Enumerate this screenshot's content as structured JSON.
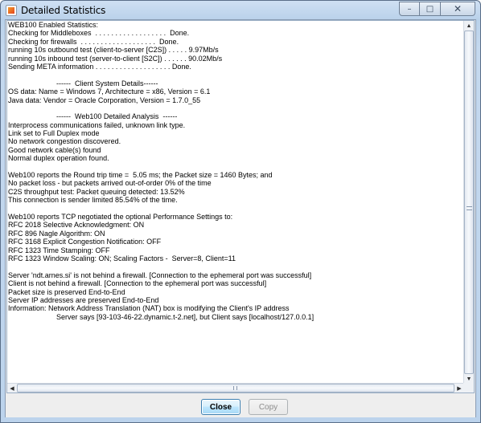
{
  "window": {
    "title": "Detailed Statistics",
    "caption_buttons": {
      "minimize": "–",
      "maximize": "□",
      "close": "✕"
    }
  },
  "text_lines": [
    "WEB100 Enabled Statistics:",
    "Checking for Middleboxes  . . . . . . . . . . . . . . . . . .  Done.",
    "Checking for firewalls  . . . . . . . . . . . . . . . . . . .  Done.",
    "running 10s outbound test (client-to-server [C2S]) . . . . . 9.97Mb/s",
    "running 10s inbound test (server-to-client [S2C]) . . . . . . 90.02Mb/s",
    "Sending META information . . . . . . . . . . . . . . . . . . . Done.",
    "",
    "                        ------  Client System Details------",
    "OS data: Name = Windows 7, Architecture = x86, Version = 6.1",
    "Java data: Vendor = Oracle Corporation, Version = 1.7.0_55",
    "",
    "                        ------  Web100 Detailed Analysis  ------",
    "Interprocess communications failed, unknown link type.",
    "Link set to Full Duplex mode",
    "No network congestion discovered.",
    "Good network cable(s) found",
    "Normal duplex operation found.",
    "",
    "Web100 reports the Round trip time =  5.05 ms; the Packet size = 1460 Bytes; and",
    "No packet loss - but packets arrived out-of-order 0% of the time",
    "C2S throughput test: Packet queuing detected: 13.52%",
    "This connection is sender limited 85.54% of the time.",
    "",
    "Web100 reports TCP negotiated the optional Performance Settings to:",
    "RFC 2018 Selective Acknowledgment: ON",
    "RFC 896 Nagle Algorithm: ON",
    "RFC 3168 Explicit Congestion Notification: OFF",
    "RFC 1323 Time Stamping: OFF",
    "RFC 1323 Window Scaling: ON; Scaling Factors -  Server=8, Client=11",
    "",
    "Server 'ndt.arnes.si' is not behind a firewall. [Connection to the ephemeral port was successful]",
    "Client is not behind a firewall. [Connection to the ephemeral port was successful]",
    "Packet size is preserved End-to-End",
    "Server IP addresses are preserved End-to-End",
    "Information: Network Address Translation (NAT) box is modifying the Client's IP address",
    "                        Server says [93-103-46-22.dynamic.t-2.net], but Client says [localhost/127.0.0.1]"
  ],
  "scrollbars": {
    "up_arrow": "▲",
    "down_arrow": "▼",
    "left_arrow": "◀",
    "right_arrow": "▶"
  },
  "buttons": {
    "close": "Close",
    "copy": "Copy"
  }
}
